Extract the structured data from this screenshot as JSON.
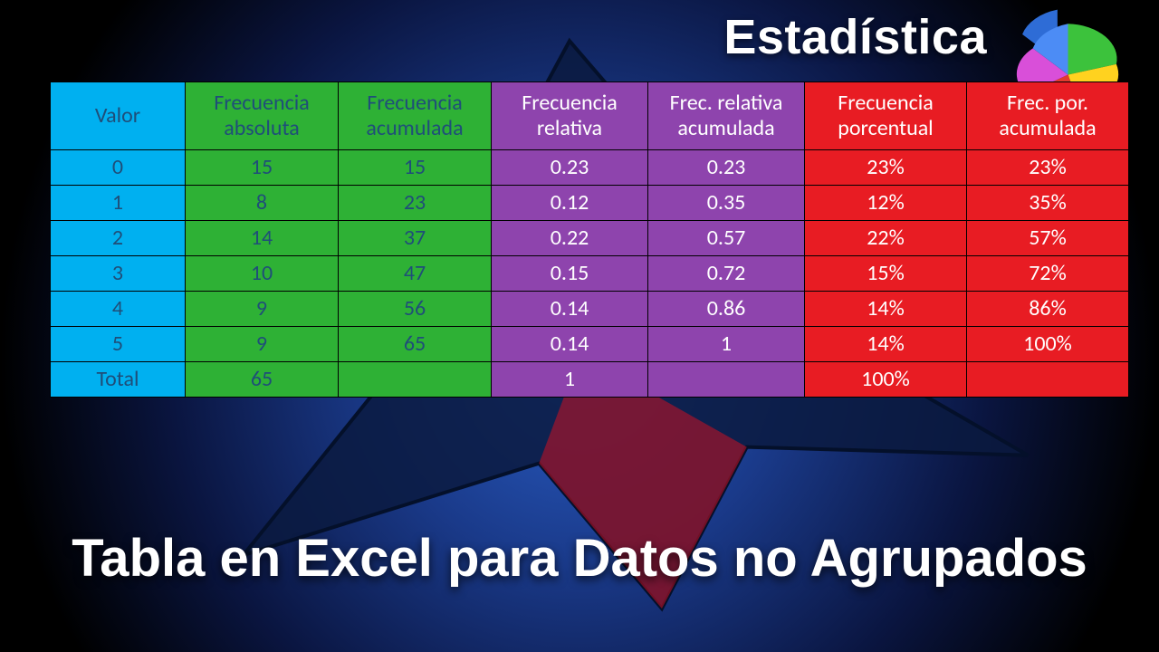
{
  "heading": "Estadística",
  "subtitle": "Tabla en Excel para Datos no Agrupados",
  "table": {
    "headers": {
      "valor": "Valor",
      "abs1": "Frecuencia",
      "abs2": "absoluta",
      "acum1": "Frecuencia",
      "acum2": "acumulada",
      "rel1": "Frecuencia",
      "rel2": "relativa",
      "relac1": "Frec. relativa",
      "relac2": "acumulada",
      "pct1": "Frecuencia",
      "pct2": "porcentual",
      "pctac1": "Frec. por.",
      "pctac2": "acumulada"
    },
    "rows": [
      {
        "valor": "0",
        "abs": "15",
        "acum": "15",
        "rel": "0.23",
        "relac": "0.23",
        "pct": "23%",
        "pctac": "23%"
      },
      {
        "valor": "1",
        "abs": "8",
        "acum": "23",
        "rel": "0.12",
        "relac": "0.35",
        "pct": "12%",
        "pctac": "35%"
      },
      {
        "valor": "2",
        "abs": "14",
        "acum": "37",
        "rel": "0.22",
        "relac": "0.57",
        "pct": "22%",
        "pctac": "57%"
      },
      {
        "valor": "3",
        "abs": "10",
        "acum": "47",
        "rel": "0.15",
        "relac": "0.72",
        "pct": "15%",
        "pctac": "72%"
      },
      {
        "valor": "4",
        "abs": "9",
        "acum": "56",
        "rel": "0.14",
        "relac": "0.86",
        "pct": "14%",
        "pctac": "86%"
      },
      {
        "valor": "5",
        "abs": "9",
        "acum": "65",
        "rel": "0.14",
        "relac": "1",
        "pct": "14%",
        "pctac": "100%"
      }
    ],
    "total": {
      "label": "Total",
      "abs": "65",
      "acum": "",
      "rel": "1",
      "relac": "",
      "pct": "100%",
      "pctac": ""
    }
  },
  "chart_data": {
    "type": "table",
    "title": "Tabla de frecuencias — datos no agrupados",
    "columns": [
      "Valor",
      "Frecuencia absoluta",
      "Frecuencia acumulada",
      "Frecuencia relativa",
      "Frec. relativa acumulada",
      "Frecuencia porcentual",
      "Frec. por. acumulada"
    ],
    "rows": [
      [
        0,
        15,
        15,
        0.23,
        0.23,
        "23%",
        "23%"
      ],
      [
        1,
        8,
        23,
        0.12,
        0.35,
        "12%",
        "35%"
      ],
      [
        2,
        14,
        37,
        0.22,
        0.57,
        "22%",
        "57%"
      ],
      [
        3,
        10,
        47,
        0.15,
        0.72,
        "15%",
        "72%"
      ],
      [
        4,
        9,
        56,
        0.14,
        0.86,
        "14%",
        "86%"
      ],
      [
        5,
        9,
        65,
        0.14,
        1.0,
        "14%",
        "100%"
      ]
    ],
    "totals": {
      "Frecuencia absoluta": 65,
      "Frecuencia relativa": 1,
      "Frecuencia porcentual": "100%"
    }
  }
}
